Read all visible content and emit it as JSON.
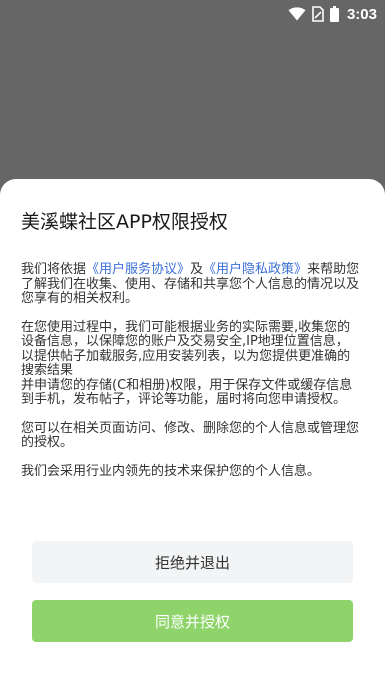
{
  "status_bar": {
    "time": "3:03",
    "icons": [
      "wifi-icon",
      "sim-no-signal-icon",
      "battery-icon"
    ]
  },
  "dialog": {
    "title": "美溪蝶社区APP权限授权",
    "intro_prefix": "我们将依据",
    "link_service": "《用户服务协议》",
    "intro_and": "及",
    "link_privacy": "《用户隐私政策》",
    "intro_suffix": "来帮助您了解我们在收集、使用、存储和共享您个人信息的情况以及您享有的相关权利。",
    "para2": "在您使用过程中，我们可能根据业务的实际需要,收集您的设备信息，以保障您的账户及交易安全,IP地理位置信息，以提供帖子加载服务,应用安装列表，以为您提供更准确的搜索结果",
    "para3": "并申请您的存储(C和相册)权限，用于保存文件或缓存信息到手机，发布帖子，评论等功能，届时将向您申请授权。",
    "para4": "您可以在相关页面访问、修改、删除您的个人信息或管理您的授权。",
    "para5": "我们会采用行业内领先的技术来保护您的个人信息。",
    "reject_label": "拒绝并退出",
    "agree_label": "同意并授权"
  },
  "colors": {
    "overlay": "#666666",
    "link": "#3a6fd8",
    "agree_button": "#8ed46a",
    "reject_button": "#f3f4f6"
  }
}
